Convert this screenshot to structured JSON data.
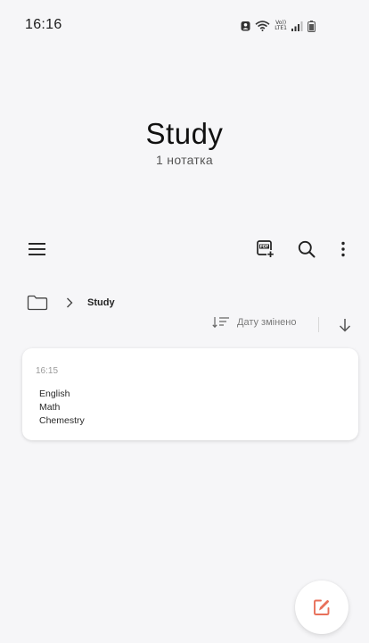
{
  "status_bar": {
    "time": "16:16",
    "volte_top": "Vo))",
    "volte_bottom": "LTE1",
    "icons": [
      "profile-lock-icon",
      "wifi-icon",
      "volte-icon",
      "signal-icon",
      "battery-icon"
    ]
  },
  "folder_header": {
    "title": "Study",
    "note_count": "1 нотатка"
  },
  "toolbar": {
    "icons": [
      "menu-icon",
      "pdf-plus-icon",
      "search-icon",
      "more-vert-icon"
    ]
  },
  "breadcrumb": {
    "icons": [
      "folder-icon",
      "chevron-right-icon"
    ],
    "current": "Study"
  },
  "sort": {
    "label": "Дату змінено",
    "icons": [
      "sort-order-icon",
      "arrow-down-icon"
    ]
  },
  "notes": [
    {
      "time": "16:15",
      "lines": [
        "English",
        "Math",
        "Chemestry"
      ]
    }
  ],
  "fab": {
    "icon": "new-note-pencil-icon",
    "accent_color": "#e8705a"
  },
  "colors": {
    "background": "#f6f6f8",
    "card": "#ffffff",
    "text_primary": "#111111",
    "text_secondary": "#7a7a7a"
  }
}
